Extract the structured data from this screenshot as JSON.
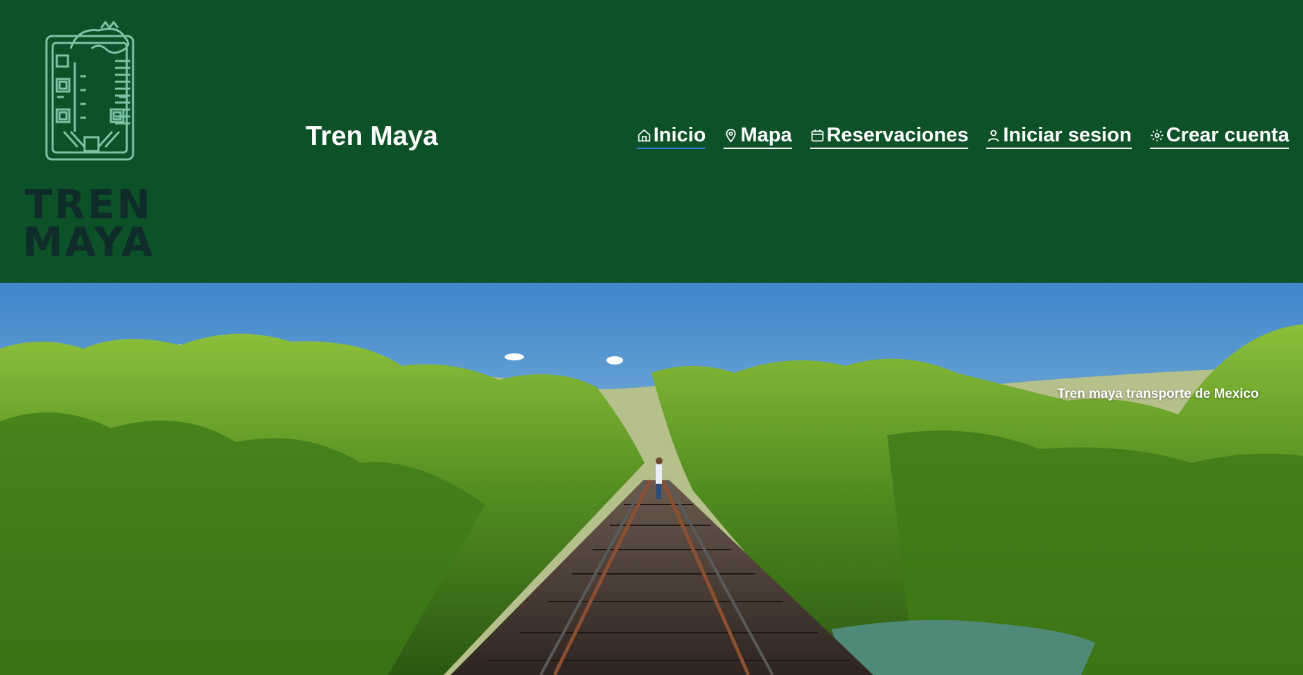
{
  "logo": {
    "line1": "TREN",
    "line2": "MAYA",
    "icon": "maya-serpent-logo"
  },
  "header": {
    "title": "Tren Maya"
  },
  "nav": {
    "items": [
      {
        "label": "Inicio",
        "icon": "home-icon",
        "active": true
      },
      {
        "label": "Mapa",
        "icon": "map-pin-icon"
      },
      {
        "label": "Reservaciones",
        "icon": "calendar-icon"
      },
      {
        "label": "Iniciar sesion",
        "icon": "user-icon"
      },
      {
        "label": "Crear cuenta",
        "icon": "gear-icon"
      }
    ]
  },
  "hero": {
    "caption": "Tren maya transporte de Mexico"
  },
  "colors": {
    "header_bg": "#0c5128",
    "logo_mark": "#7cc4a6",
    "logo_text": "#0f2b2a",
    "active_underline": "#2e7bd6"
  }
}
